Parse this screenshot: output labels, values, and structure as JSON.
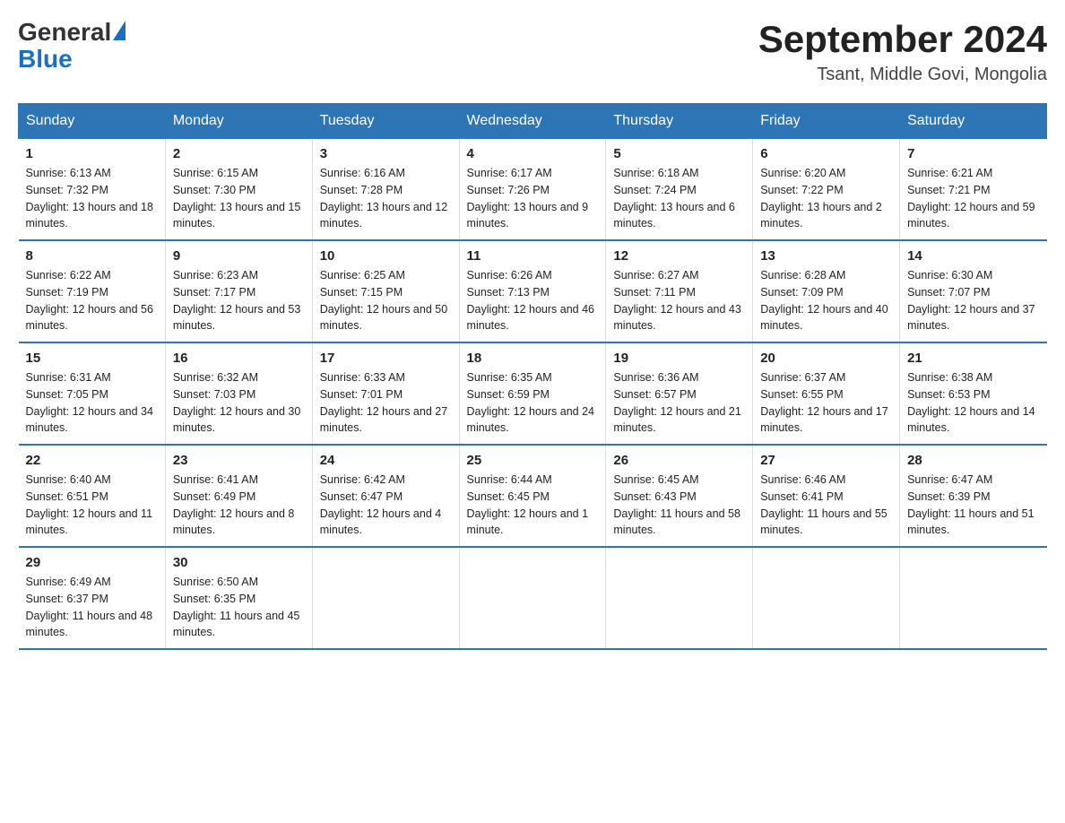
{
  "header": {
    "logo_general": "General",
    "logo_blue": "Blue",
    "month_year": "September 2024",
    "location": "Tsant, Middle Govi, Mongolia"
  },
  "days_of_week": [
    "Sunday",
    "Monday",
    "Tuesday",
    "Wednesday",
    "Thursday",
    "Friday",
    "Saturday"
  ],
  "weeks": [
    [
      {
        "day": "1",
        "sunrise": "6:13 AM",
        "sunset": "7:32 PM",
        "daylight": "13 hours and 18 minutes."
      },
      {
        "day": "2",
        "sunrise": "6:15 AM",
        "sunset": "7:30 PM",
        "daylight": "13 hours and 15 minutes."
      },
      {
        "day": "3",
        "sunrise": "6:16 AM",
        "sunset": "7:28 PM",
        "daylight": "13 hours and 12 minutes."
      },
      {
        "day": "4",
        "sunrise": "6:17 AM",
        "sunset": "7:26 PM",
        "daylight": "13 hours and 9 minutes."
      },
      {
        "day": "5",
        "sunrise": "6:18 AM",
        "sunset": "7:24 PM",
        "daylight": "13 hours and 6 minutes."
      },
      {
        "day": "6",
        "sunrise": "6:20 AM",
        "sunset": "7:22 PM",
        "daylight": "13 hours and 2 minutes."
      },
      {
        "day": "7",
        "sunrise": "6:21 AM",
        "sunset": "7:21 PM",
        "daylight": "12 hours and 59 minutes."
      }
    ],
    [
      {
        "day": "8",
        "sunrise": "6:22 AM",
        "sunset": "7:19 PM",
        "daylight": "12 hours and 56 minutes."
      },
      {
        "day": "9",
        "sunrise": "6:23 AM",
        "sunset": "7:17 PM",
        "daylight": "12 hours and 53 minutes."
      },
      {
        "day": "10",
        "sunrise": "6:25 AM",
        "sunset": "7:15 PM",
        "daylight": "12 hours and 50 minutes."
      },
      {
        "day": "11",
        "sunrise": "6:26 AM",
        "sunset": "7:13 PM",
        "daylight": "12 hours and 46 minutes."
      },
      {
        "day": "12",
        "sunrise": "6:27 AM",
        "sunset": "7:11 PM",
        "daylight": "12 hours and 43 minutes."
      },
      {
        "day": "13",
        "sunrise": "6:28 AM",
        "sunset": "7:09 PM",
        "daylight": "12 hours and 40 minutes."
      },
      {
        "day": "14",
        "sunrise": "6:30 AM",
        "sunset": "7:07 PM",
        "daylight": "12 hours and 37 minutes."
      }
    ],
    [
      {
        "day": "15",
        "sunrise": "6:31 AM",
        "sunset": "7:05 PM",
        "daylight": "12 hours and 34 minutes."
      },
      {
        "day": "16",
        "sunrise": "6:32 AM",
        "sunset": "7:03 PM",
        "daylight": "12 hours and 30 minutes."
      },
      {
        "day": "17",
        "sunrise": "6:33 AM",
        "sunset": "7:01 PM",
        "daylight": "12 hours and 27 minutes."
      },
      {
        "day": "18",
        "sunrise": "6:35 AM",
        "sunset": "6:59 PM",
        "daylight": "12 hours and 24 minutes."
      },
      {
        "day": "19",
        "sunrise": "6:36 AM",
        "sunset": "6:57 PM",
        "daylight": "12 hours and 21 minutes."
      },
      {
        "day": "20",
        "sunrise": "6:37 AM",
        "sunset": "6:55 PM",
        "daylight": "12 hours and 17 minutes."
      },
      {
        "day": "21",
        "sunrise": "6:38 AM",
        "sunset": "6:53 PM",
        "daylight": "12 hours and 14 minutes."
      }
    ],
    [
      {
        "day": "22",
        "sunrise": "6:40 AM",
        "sunset": "6:51 PM",
        "daylight": "12 hours and 11 minutes."
      },
      {
        "day": "23",
        "sunrise": "6:41 AM",
        "sunset": "6:49 PM",
        "daylight": "12 hours and 8 minutes."
      },
      {
        "day": "24",
        "sunrise": "6:42 AM",
        "sunset": "6:47 PM",
        "daylight": "12 hours and 4 minutes."
      },
      {
        "day": "25",
        "sunrise": "6:44 AM",
        "sunset": "6:45 PM",
        "daylight": "12 hours and 1 minute."
      },
      {
        "day": "26",
        "sunrise": "6:45 AM",
        "sunset": "6:43 PM",
        "daylight": "11 hours and 58 minutes."
      },
      {
        "day": "27",
        "sunrise": "6:46 AM",
        "sunset": "6:41 PM",
        "daylight": "11 hours and 55 minutes."
      },
      {
        "day": "28",
        "sunrise": "6:47 AM",
        "sunset": "6:39 PM",
        "daylight": "11 hours and 51 minutes."
      }
    ],
    [
      {
        "day": "29",
        "sunrise": "6:49 AM",
        "sunset": "6:37 PM",
        "daylight": "11 hours and 48 minutes."
      },
      {
        "day": "30",
        "sunrise": "6:50 AM",
        "sunset": "6:35 PM",
        "daylight": "11 hours and 45 minutes."
      },
      null,
      null,
      null,
      null,
      null
    ]
  ]
}
